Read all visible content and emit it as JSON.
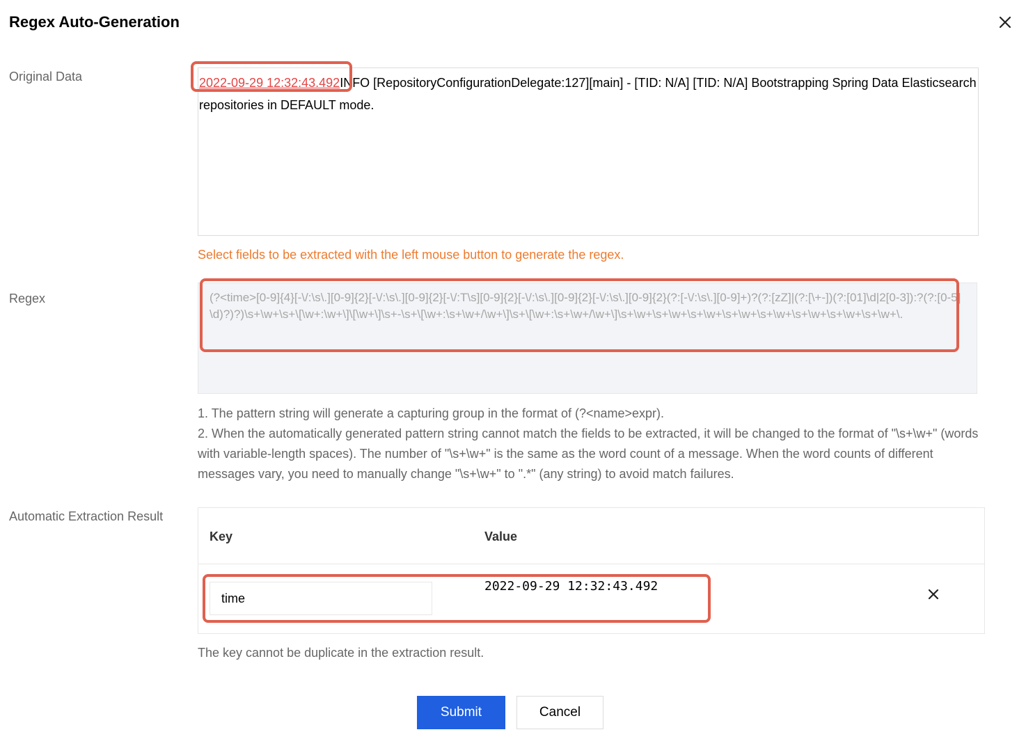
{
  "dialog": {
    "title": "Regex Auto-Generation"
  },
  "original_data": {
    "label": "Original Data",
    "selected_text": "2022-09-29 12:32:43.492",
    "remaining_text": "INFO  [RepositoryConfigurationDelegate:127][main]  - [TID: N/A] [TID: N/A] Bootstrapping Spring Data Elasticsearch repositories in DEFAULT mode.",
    "hint": "Select fields to be extracted with the left mouse button to generate the regex."
  },
  "regex": {
    "label": "Regex",
    "value": "(?<time>[0-9]{4}[-\\/:\\s\\.][0-9]{2}[-\\/:\\s\\.][0-9]{2}[-\\/:T\\s][0-9]{2}[-\\/:\\s\\.][0-9]{2}[-\\/:\\s\\.][0-9]{2}(?:[-\\/:\\s\\.][0-9]+)?(?:[zZ]|(?:[\\+-])(?:[01]\\d|2[0-3]):?(?:[0-5]\\d)?)?)\\s+\\w+\\s+\\[\\w+:\\w+\\]\\[\\w+\\]\\s+-\\s+\\[\\w+:\\s+\\w+/\\w+\\]\\s+\\[\\w+:\\s+\\w+/\\w+\\]\\s+\\w+\\s+\\w+\\s+\\w+\\s+\\w+\\s+\\w+\\s+\\w+\\s+\\w+\\s+\\w+\\.",
    "note_1": "1. The pattern string will generate a capturing group in the format of (?<name>expr).",
    "note_2": "2. When the automatically generated pattern string cannot match the fields to be extracted, it will be changed to the format of \"\\s+\\w+\" (words with variable-length spaces). The number of \"\\s+\\w+\" is the same as the word count of a message. When the word counts of different messages vary, you need to manually change \"\\s+\\w+\" to \".*\" (any string) to avoid match failures."
  },
  "extraction": {
    "label": "Automatic Extraction Result",
    "columns": {
      "key": "Key",
      "value": "Value"
    },
    "rows": [
      {
        "key": "time",
        "value": "2022-09-29 12:32:43.492"
      }
    ],
    "hint": "The key cannot be duplicate in the extraction result."
  },
  "buttons": {
    "submit": "Submit",
    "cancel": "Cancel"
  },
  "colors": {
    "primary": "#1f5fe0",
    "warning": "#ed7b2f",
    "annotation": "#e0604f",
    "selected_text": "#e54545"
  },
  "icons": {
    "dialog_close": "close-icon",
    "row_delete": "close-icon"
  }
}
